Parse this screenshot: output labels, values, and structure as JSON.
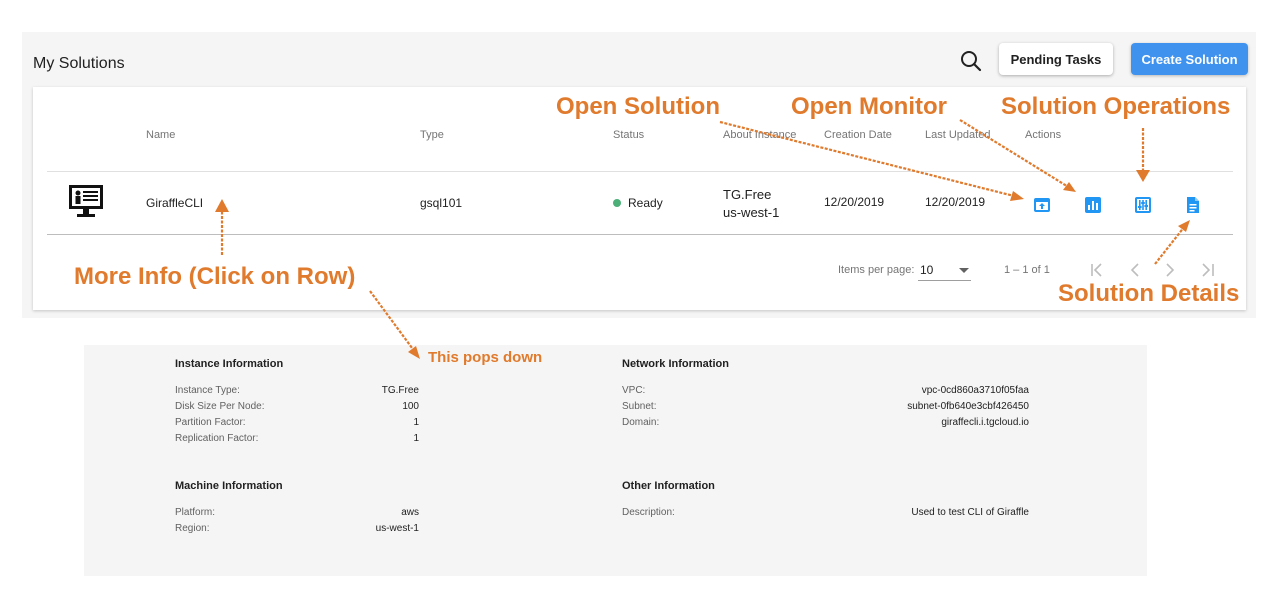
{
  "header": {
    "title": "My Solutions",
    "pending_label": "Pending Tasks",
    "create_label": "Create Solution"
  },
  "table": {
    "columns": [
      "Name",
      "Type",
      "Status",
      "About Instance",
      "Creation Date",
      "Last Updated",
      "Actions"
    ],
    "row": {
      "name": "GiraffleCLI",
      "type": "gsql101",
      "status": "Ready",
      "instance_line1": "TG.Free",
      "instance_line2": "us-west-1",
      "creation_date": "12/20/2019",
      "last_updated": "12/20/2019"
    },
    "status_color": "#4caf78"
  },
  "pagination": {
    "items_per_page_label": "Items per page:",
    "items_per_page_value": "10",
    "range": "1 – 1 of 1"
  },
  "annotations": {
    "open_solution": "Open Solution",
    "open_monitor": "Open Monitor",
    "solution_operations": "Solution Operations",
    "more_info": "More Info (Click on Row)",
    "solution_details": "Solution Details",
    "pops_down": "This pops down",
    "color": "#e07a2c"
  },
  "details": {
    "instance": {
      "title": "Instance Information",
      "rows": [
        {
          "k": "Instance Type:",
          "v": "TG.Free"
        },
        {
          "k": "Disk Size Per Node:",
          "v": "100"
        },
        {
          "k": "Partition Factor:",
          "v": "1"
        },
        {
          "k": "Replication Factor:",
          "v": "1"
        }
      ]
    },
    "network": {
      "title": "Network Information",
      "rows": [
        {
          "k": "VPC:",
          "v": "vpc-0cd860a3710f05faa"
        },
        {
          "k": "Subnet:",
          "v": "subnet-0fb640e3cbf426450"
        },
        {
          "k": "Domain:",
          "v": "giraffecli.i.tgcloud.io"
        }
      ]
    },
    "machine": {
      "title": "Machine Information",
      "rows": [
        {
          "k": "Platform:",
          "v": "aws"
        },
        {
          "k": "Region:",
          "v": "us-west-1"
        }
      ]
    },
    "other": {
      "title": "Other Information",
      "rows": [
        {
          "k": "Description:",
          "v": "Used to test CLI of Giraffle"
        }
      ]
    }
  },
  "colors": {
    "accent": "#3f93ef",
    "icon_blue": "#2196f3"
  },
  "icons": [
    "search-icon",
    "desktop-icon",
    "open-solution-icon",
    "monitor-icon",
    "operations-icon",
    "details-icon",
    "first-page-icon",
    "prev-page-icon",
    "next-page-icon",
    "last-page-icon"
  ]
}
